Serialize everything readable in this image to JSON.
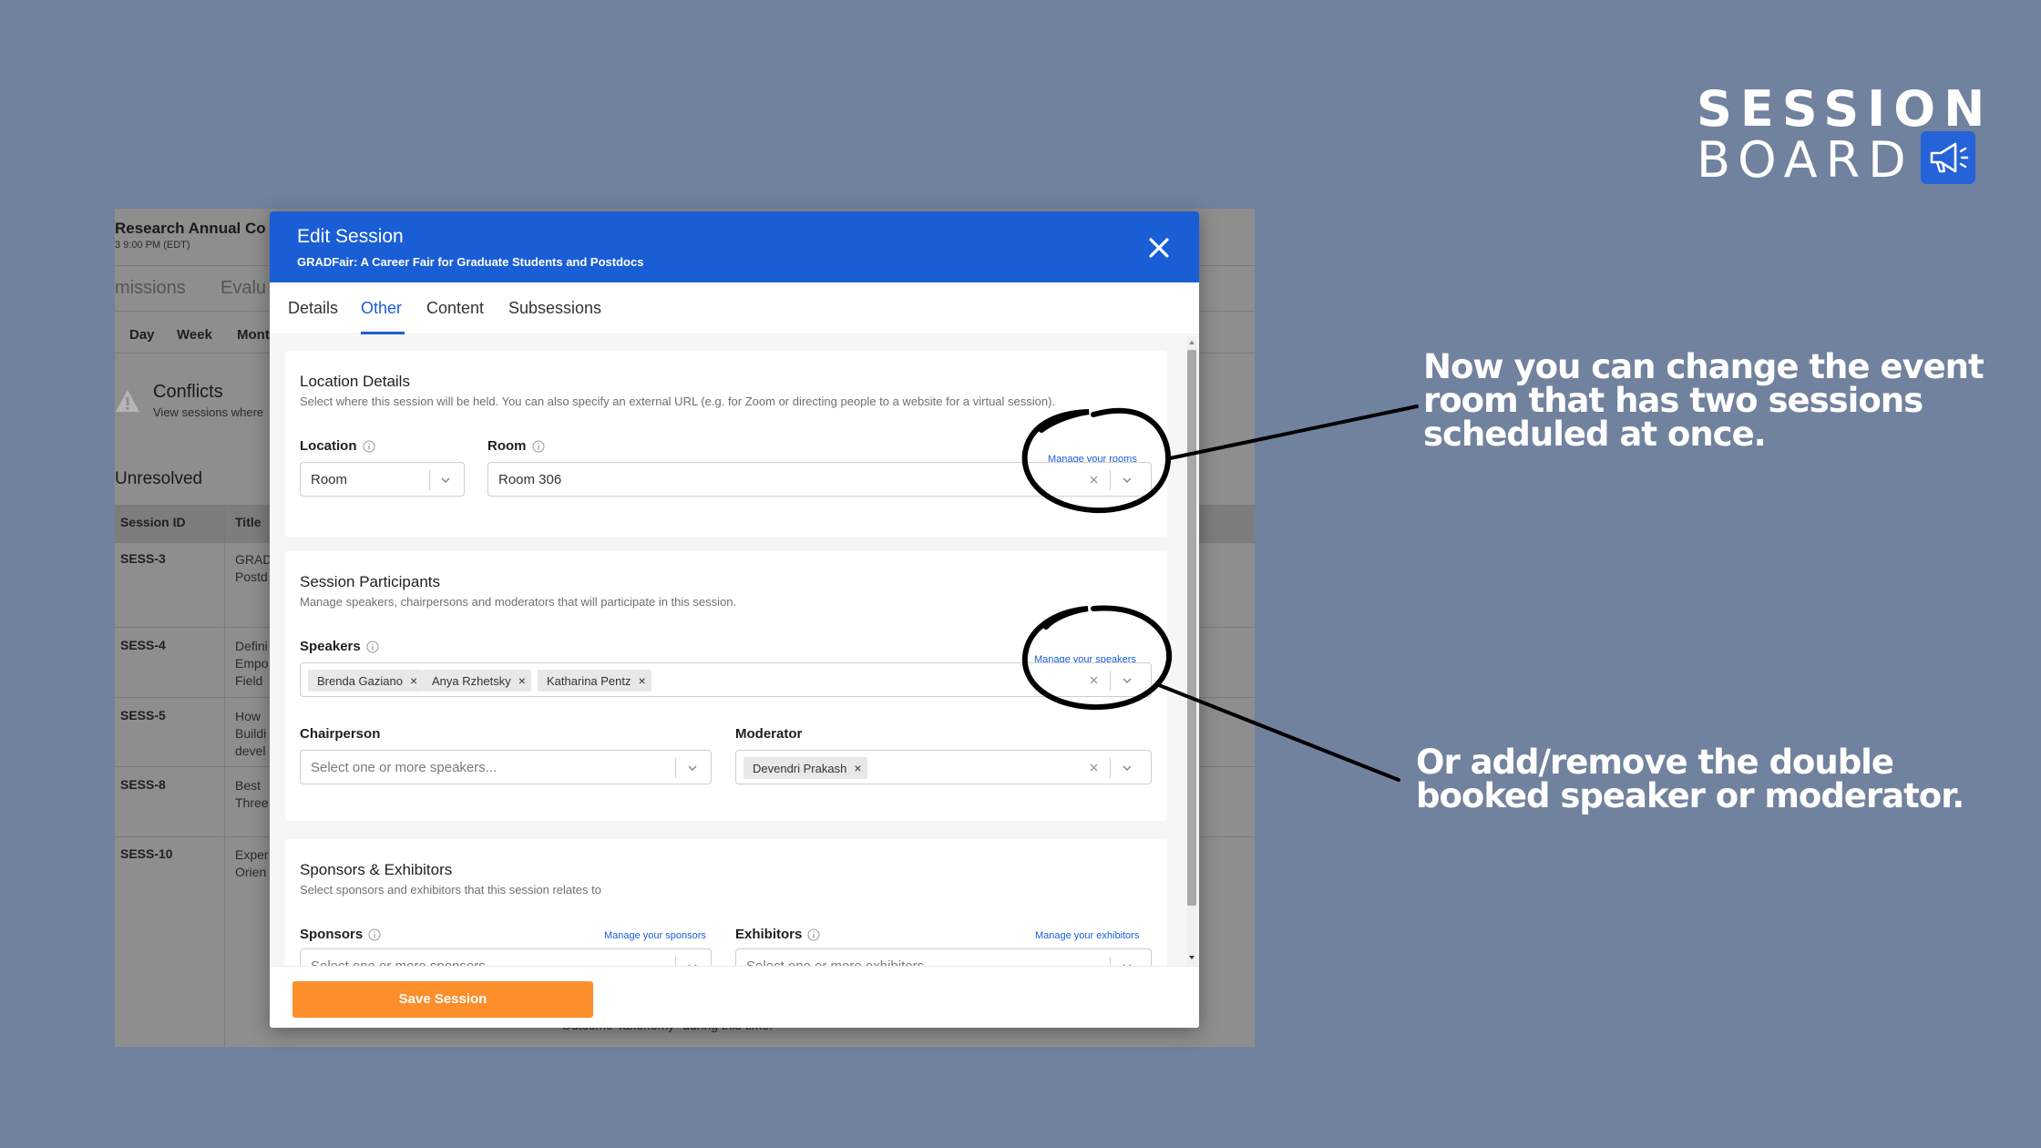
{
  "logo": {
    "line1": "SESSION",
    "line2": "BOARD",
    "badge_icon": "megaphone-icon"
  },
  "background_app": {
    "title": "Research Annual Co",
    "subtitle": "3 9:00 PM (EDT)",
    "tabs": [
      "missions",
      "Evalu"
    ],
    "views": [
      "Day",
      "Week",
      "Mont"
    ],
    "conflicts_title": "Conflicts",
    "conflicts_subtitle": "View sessions where",
    "unresolved_label": "Unresolved",
    "table_headers": [
      "Session ID",
      "Title"
    ],
    "rows": [
      {
        "id": "SESS-3",
        "title_lines": [
          "GRAD",
          "Postd"
        ]
      },
      {
        "id": "SESS-4",
        "title_lines": [
          "Defini",
          "Empo",
          "Field"
        ]
      },
      {
        "id": "SESS-5",
        "title_lines": [
          "How",
          "Buildi",
          "devel"
        ]
      },
      {
        "id": "SESS-8",
        "title_lines": [
          "Best",
          "Three"
        ]
      },
      {
        "id": "SESS-10",
        "title_lines": [
          "Exper",
          "Orien"
        ]
      }
    ],
    "footer_text": "Outcome Taxonomy\" during this time."
  },
  "modal": {
    "title": "Edit Session",
    "subtitle": "GRADFair: A Career Fair for Graduate Students and Postdocs",
    "tabs": [
      {
        "label": "Details",
        "active": false
      },
      {
        "label": "Other",
        "active": true
      },
      {
        "label": "Content",
        "active": false
      },
      {
        "label": "Subsessions",
        "active": false
      }
    ],
    "location_details": {
      "title": "Location Details",
      "description": "Select where this session will be held. You can also specify an external URL (e.g. for Zoom or directing people to a website for a virtual session).",
      "location_label": "Location",
      "location_value": "Room",
      "room_label": "Room",
      "room_value": "Room 306",
      "manage_link": "Manage your rooms"
    },
    "participants": {
      "title": "Session Participants",
      "description": "Manage speakers, chairpersons and moderators that will participate in this session.",
      "speakers_label": "Speakers",
      "manage_link": "Manage your speakers",
      "speakers": [
        "Brenda Gaziano",
        "Anya Rzhetsky",
        "Katharina Pentz"
      ],
      "chairperson_label": "Chairperson",
      "chairperson_placeholder": "Select one or more speakers...",
      "moderator_label": "Moderator",
      "moderators": [
        "Devendri Prakash"
      ]
    },
    "sponsors": {
      "title": "Sponsors & Exhibitors",
      "description": "Select sponsors and exhibitors that this session relates to",
      "sponsors_label": "Sponsors",
      "sponsors_manage": "Manage your sponsors",
      "sponsors_placeholder": "Select one or more sponsors...",
      "exhibitors_label": "Exhibitors",
      "exhibitors_manage": "Manage your exhibitors",
      "exhibitors_placeholder": "Select one or more exhibitors..."
    },
    "save_label": "Save Session",
    "chip_remove": "×"
  },
  "annotations": {
    "callout_1": "Now you can change the event room that has two sessions scheduled at once.",
    "callout_2": "Or add/remove the double booked speaker or moderator."
  },
  "colors": {
    "background": "#71829e",
    "header_blue": "#1a5ed6",
    "save_orange": "#fd8e2c",
    "logo_badge": "#2563d9"
  }
}
